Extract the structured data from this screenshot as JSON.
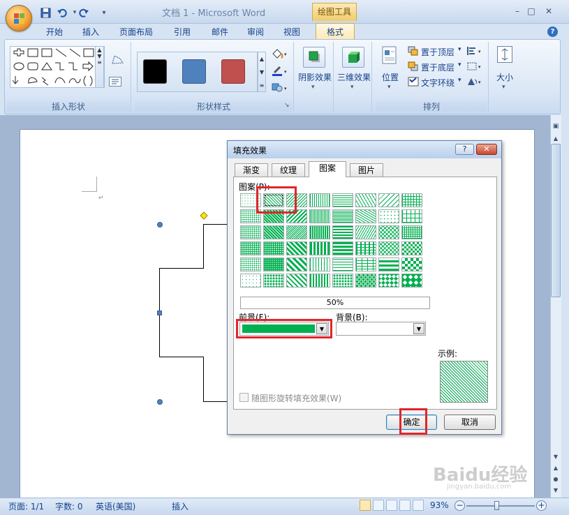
{
  "window": {
    "title": "文档 1 - Microsoft Word",
    "context_group": "绘图工具",
    "controls": {
      "minimize": "–",
      "maximize": "□",
      "close": "✕"
    }
  },
  "quick_access": {
    "save_icon": "save-icon",
    "undo_icon": "undo-icon",
    "redo_icon": "redo-icon",
    "more": "▾"
  },
  "ribbon": {
    "tabs": [
      "开始",
      "插入",
      "页面布局",
      "引用",
      "邮件",
      "审阅",
      "视图",
      "格式"
    ],
    "active_tab": "格式",
    "help": "?",
    "groups": {
      "insert_shapes": "插入形状",
      "shape_styles": "形状样式",
      "shadow_effects": "阴影效果",
      "threed_effects": "三维效果",
      "arrange": "排列",
      "size": "大小"
    },
    "arrange_items": {
      "position": "位置",
      "bring_to_front": "置于顶层",
      "send_to_back": "置于底层",
      "text_wrap": "文字环绕"
    },
    "style_swatches": [
      "#000000",
      "#4f81bd",
      "#c0504d"
    ]
  },
  "dialog": {
    "title": "填充效果",
    "help_btn": "?",
    "close_btn": "✕",
    "tabs": [
      "渐变",
      "纹理",
      "图案",
      "图片"
    ],
    "active_tab": "图案",
    "pattern_label": "图案(P):",
    "pattern_name": "50%",
    "foreground_label": "前景(F):",
    "foreground_color": "#00b050",
    "background_label": "背景(B):",
    "background_color": "#ffffff",
    "sample_label": "示例:",
    "rotate_checkbox": "随图形旋转填充效果(W)",
    "ok": "确定",
    "cancel": "取消",
    "selected_pattern_index": 1
  },
  "statusbar": {
    "page": "页面: 1/1",
    "words": "字数: 0",
    "language": "英语(美国)",
    "insert_mode": "插入",
    "zoom": "93%",
    "zoom_minus": "−",
    "zoom_plus": "+"
  },
  "watermark": {
    "text": "Baidu经验",
    "url": "jingyan.baidu.com"
  }
}
